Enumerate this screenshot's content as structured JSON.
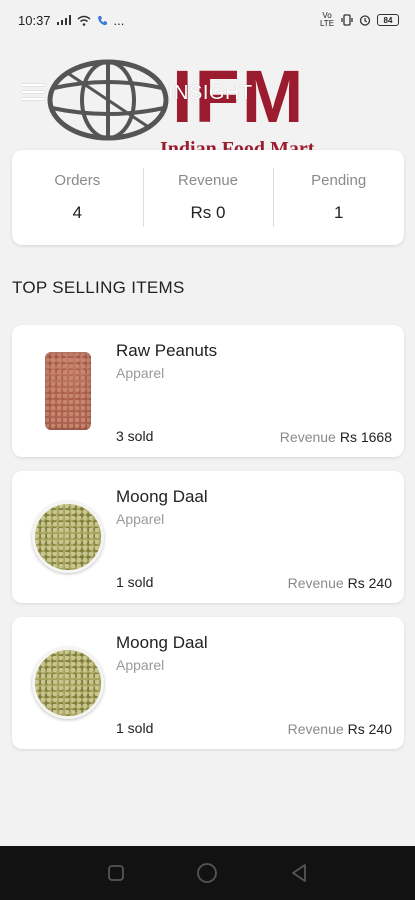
{
  "status_bar": {
    "time": "10:37",
    "signal_text": "...",
    "network_labels": "Vo LTE",
    "battery": "84"
  },
  "header": {
    "title": "INSIGHT",
    "logo_text": "IFM",
    "logo_subtitle": "Indian Food Mart",
    "brand_color": "#9b1c2e"
  },
  "stats": [
    {
      "label": "Orders",
      "value": "4"
    },
    {
      "label": "Revenue",
      "value": "Rs 0"
    },
    {
      "label": "Pending",
      "value": "1"
    }
  ],
  "section_title": "TOP SELLING ITEMS",
  "items": [
    {
      "name": "Raw Peanuts",
      "category": "Apparel",
      "sold": "3 sold",
      "revenue_label": "Revenue",
      "revenue_value": "Rs 1668",
      "thumb": "peanut-bag-image"
    },
    {
      "name": "Moong Daal",
      "category": "Apparel",
      "sold": "1 sold",
      "revenue_label": "Revenue",
      "revenue_value": "Rs 240",
      "thumb": "daal-bowl-image"
    },
    {
      "name": "Moong Daal",
      "category": "Apparel",
      "sold": "1 sold",
      "revenue_label": "Revenue",
      "revenue_value": "Rs 240",
      "thumb": "daal-bowl-image"
    }
  ],
  "nav": {
    "icons": [
      "square-icon",
      "circle-icon",
      "triangle-back-icon"
    ]
  }
}
